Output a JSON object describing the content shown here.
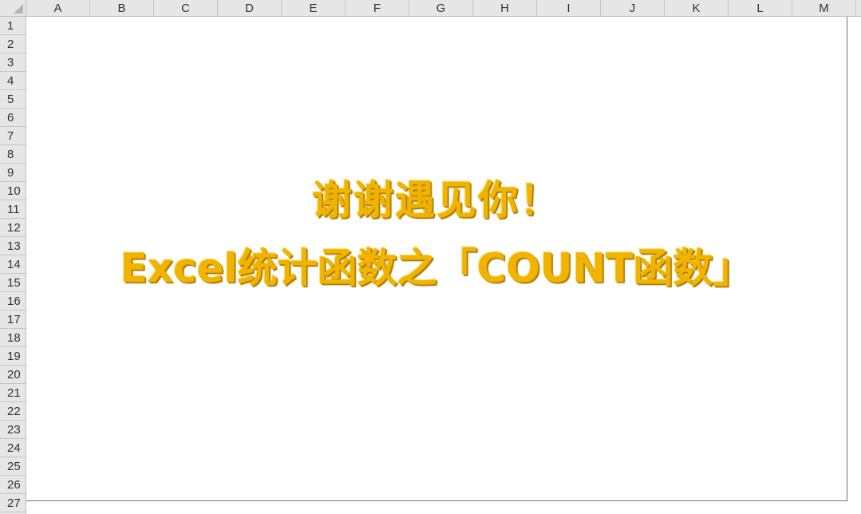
{
  "columns": [
    "A",
    "B",
    "C",
    "D",
    "E",
    "F",
    "G",
    "H",
    "I",
    "J",
    "K",
    "L",
    "M"
  ],
  "rows": [
    "1",
    "2",
    "3",
    "4",
    "5",
    "6",
    "7",
    "8",
    "9",
    "10",
    "11",
    "12",
    "13",
    "14",
    "15",
    "16",
    "17",
    "18",
    "19",
    "20",
    "21",
    "22",
    "23",
    "24",
    "25",
    "26",
    "27"
  ],
  "picture": {
    "line1": "谢谢遇见你！",
    "line2": "Excel统计函数之「COUNT函数」"
  },
  "colors": {
    "text_gold": "#f0b400",
    "header_bg": "#e6e6e6"
  }
}
